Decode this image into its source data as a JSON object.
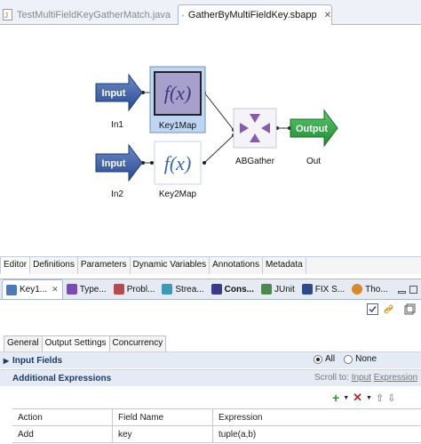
{
  "editor_tabs": [
    {
      "label": "TestMultiFieldKeyGatherMatch.java",
      "active": false
    },
    {
      "label": "GatherByMultiFieldKey.sbapp",
      "active": true
    }
  ],
  "canvas": {
    "nodes": {
      "in1": {
        "text": "Input",
        "label": "In1"
      },
      "in2": {
        "text": "Input",
        "label": "In2"
      },
      "key1map": {
        "text": "f(x)",
        "label": "Key1Map"
      },
      "key2map": {
        "text": "f(x)",
        "label": "Key2Map"
      },
      "abgather": {
        "label": "ABGather"
      },
      "out": {
        "text": "Output",
        "label": "Out"
      }
    }
  },
  "editor_bottom_tabs": [
    "Editor",
    "Definitions",
    "Parameters",
    "Dynamic Variables",
    "Annotations",
    "Metadata"
  ],
  "view_tabs": [
    {
      "label": "Key1...",
      "icon": "map-icon",
      "color": "#4a7ab8"
    },
    {
      "label": "Type...",
      "icon": "type-icon",
      "color": "#7a4ab8"
    },
    {
      "label": "Probl...",
      "icon": "problems-icon",
      "color": "#b84a4a"
    },
    {
      "label": "Strea...",
      "icon": "stream-icon",
      "color": "#3a9ab8"
    },
    {
      "label": "Cons...",
      "icon": "console-icon",
      "color": "#3a3a8a"
    },
    {
      "label": "JUnit",
      "icon": "junit-icon",
      "color": "#4a8a4a"
    },
    {
      "label": "FIX S...",
      "icon": "fix-icon",
      "color": "#2a4a8a"
    },
    {
      "label": "Tho...",
      "icon": "thread-icon",
      "color": "#d88a2a"
    }
  ],
  "sub_tabs": [
    "General",
    "Output Settings",
    "Concurrency"
  ],
  "input_fields": {
    "label": "Input Fields",
    "options": [
      "All",
      "None"
    ],
    "selected": "All"
  },
  "additional_expressions": {
    "label": "Additional Expressions",
    "scroll_to_label": "Scroll to:",
    "scroll_links": [
      "Input",
      "Expression"
    ]
  },
  "table": {
    "headers": [
      "Action",
      "Field Name",
      "Expression"
    ],
    "rows": [
      [
        "Add",
        "key",
        "tuple(a,b)"
      ]
    ]
  }
}
